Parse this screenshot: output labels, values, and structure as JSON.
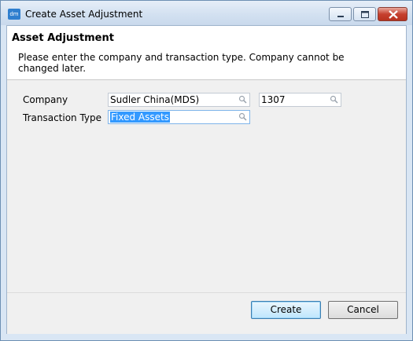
{
  "window": {
    "title": "Create Asset Adjustment",
    "app_icon_text": "dm"
  },
  "header": {
    "title": "Asset Adjustment",
    "description": "Please enter the company and transaction type. Company cannot be changed later."
  },
  "form": {
    "company_label": "Company",
    "company_value": "Sudler China(MDS)",
    "company_code": "1307",
    "transaction_type_label": "Transaction Type",
    "transaction_type_value": "Fixed Assets"
  },
  "buttons": {
    "create": "Create",
    "cancel": "Cancel"
  },
  "icons": {
    "lookup": "magnifier-icon",
    "minimize": "minimize-icon",
    "maximize": "maximize-icon",
    "close": "close-icon"
  }
}
